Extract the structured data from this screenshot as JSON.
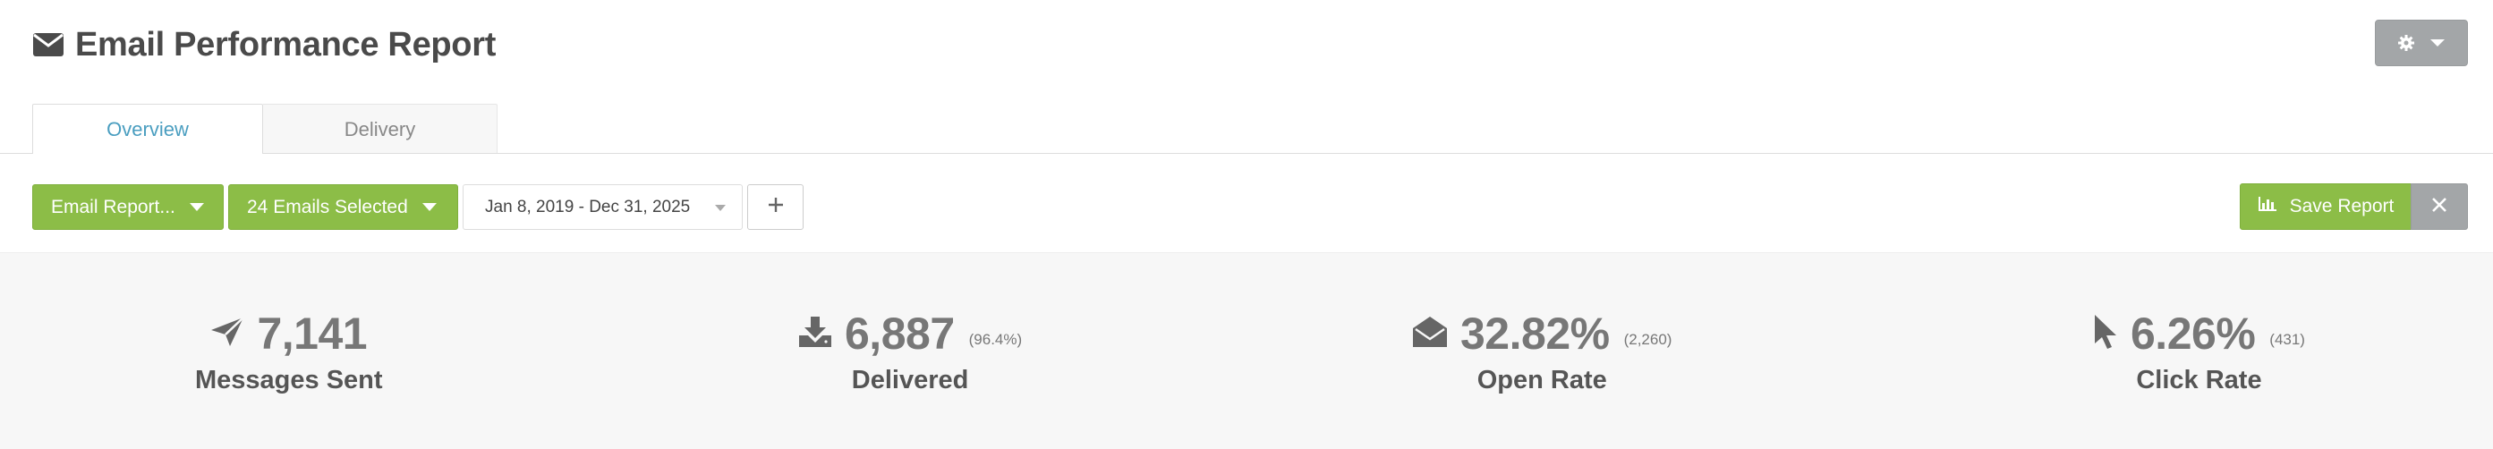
{
  "header": {
    "title": "Email Performance Report",
    "icon": "envelope-icon"
  },
  "tabs": [
    {
      "label": "Overview",
      "active": true
    },
    {
      "label": "Delivery",
      "active": false
    }
  ],
  "toolbar": {
    "report_button": "Email Report...",
    "emails_button": "24 Emails Selected",
    "date_range": "Jan 8, 2019 - Dec 31, 2025",
    "add_label": "+",
    "save_button": "Save Report"
  },
  "stats": [
    {
      "icon": "paper-plane-icon",
      "value": "7,141",
      "sub": "",
      "label": "Messages Sent"
    },
    {
      "icon": "download-icon",
      "value": "6,887",
      "sub": "(96.4%)",
      "label": "Delivered"
    },
    {
      "icon": "open-envelope-icon",
      "value": "32.82%",
      "sub": "(2,260)",
      "label": "Open Rate"
    },
    {
      "icon": "cursor-icon",
      "value": "6.26%",
      "sub": "(431)",
      "label": "Click Rate"
    }
  ],
  "colors": {
    "primary_green": "#8cbd47",
    "neutral_gray": "#a3a6a8",
    "tab_active_text": "#4a9ec0",
    "stats_background": "#f7f7f7"
  }
}
